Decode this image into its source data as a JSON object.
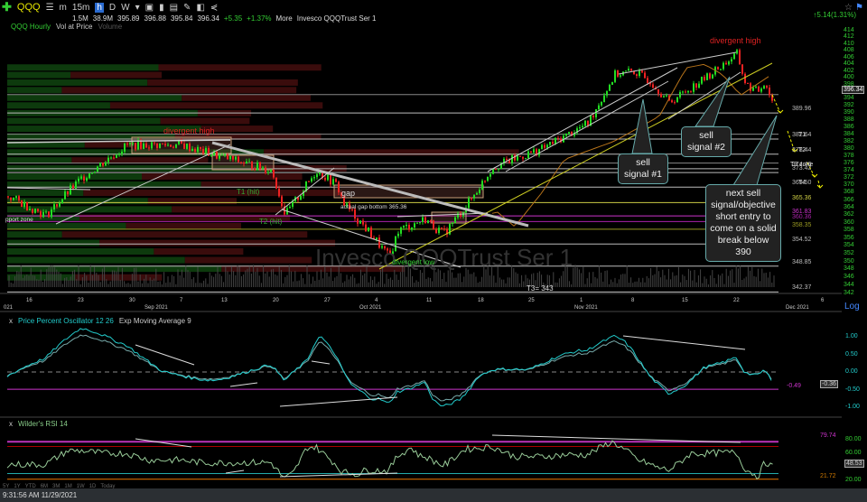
{
  "toolbar": {
    "symbol": "QQQ",
    "intervals": [
      "m",
      "15m",
      "h",
      "D",
      "W"
    ],
    "active_interval": "h"
  },
  "quote": {
    "volume": "1.5M",
    "avg_volume": "38.9M",
    "open": "395.89",
    "high": "396.88",
    "low": "395.84",
    "last": "396.34",
    "change": "+5.35",
    "change_pct": "+1.37%",
    "more": "More",
    "name": "Invesco QQQTrust Ser 1"
  },
  "right_change": "5.14(1.31%)",
  "legend": {
    "series": "QQQ Hourly",
    "vap": "Vol at Price",
    "volume": "Volume"
  },
  "watermark": "Invesco QQQTrust Ser 1",
  "price_axis": {
    "ticks": [
      414,
      412,
      410,
      408,
      406,
      404,
      402,
      400,
      398,
      396,
      394,
      392,
      390,
      388,
      386,
      384,
      382,
      380,
      378,
      376,
      374,
      372,
      370,
      368,
      366,
      364,
      362,
      360,
      358,
      356,
      354,
      352,
      350,
      348,
      346,
      344,
      342
    ],
    "current": "396.34",
    "scale": "Log"
  },
  "levels": [
    {
      "value": 389.96,
      "label": "389.96",
      "tag": "",
      "color": "#bbbbbb"
    },
    {
      "value": 382.64,
      "label": "382.64",
      "tag": "T1",
      "color": "#bbbbbb"
    },
    {
      "value": 378.44,
      "label": "378.44",
      "tag": "T2",
      "color": "#bbbbbb"
    },
    {
      "value": 374.46,
      "label": "374.46",
      "tag": "T3 zone",
      "color": "#bbbbbb"
    },
    {
      "value": 373.42,
      "label": "373.42",
      "tag": "",
      "color": "#bbbbbb"
    },
    {
      "value": 369.5,
      "label": "369.50",
      "tag": "T4",
      "color": "#bbbbbb"
    },
    {
      "value": 365.36,
      "label": "365.36",
      "tag": "",
      "color": "#cccc44"
    },
    {
      "value": 361.83,
      "label": "361.83",
      "tag": "",
      "color": "#cc33cc"
    },
    {
      "value": 360.36,
      "label": "360.36",
      "tag": "",
      "color": "#aa22aa"
    },
    {
      "value": 358.35,
      "label": "358.35",
      "tag": "",
      "color": "#999922"
    },
    {
      "value": 354.52,
      "label": "354.52",
      "tag": "",
      "color": "#bbbbbb"
    },
    {
      "value": 348.85,
      "label": "348.85",
      "tag": "",
      "color": "#bbbbbb"
    },
    {
      "value": 342.37,
      "label": "342.37",
      "tag": "",
      "color": "#bbbbbb"
    }
  ],
  "date_axis": {
    "days": [
      "16",
      "23",
      "30",
      "7",
      "13",
      "20",
      "27",
      "4",
      "11",
      "18",
      "25",
      "1",
      "8",
      "15",
      "22",
      "6"
    ],
    "months": [
      "Sep 2021",
      "Oct 2021",
      "Nov 2021",
      "Dec 2021"
    ],
    "left_month": "021"
  },
  "chart_data": {
    "type": "candlestick",
    "path": [
      [
        0,
        368
      ],
      [
        50,
        362
      ],
      [
        90,
        372
      ],
      [
        140,
        381
      ],
      [
        200,
        381
      ],
      [
        240,
        378
      ],
      [
        300,
        374
      ],
      [
        315,
        362
      ],
      [
        350,
        374
      ],
      [
        372,
        370
      ],
      [
        380,
        365
      ],
      [
        410,
        357
      ],
      [
        430,
        351
      ],
      [
        440,
        358
      ],
      [
        470,
        361
      ],
      [
        490,
        357
      ],
      [
        520,
        366
      ],
      [
        545,
        375
      ],
      [
        600,
        380
      ],
      [
        650,
        387
      ],
      [
        680,
        401
      ],
      [
        700,
        402
      ],
      [
        720,
        399
      ],
      [
        740,
        393
      ],
      [
        780,
        400
      ],
      [
        815,
        407
      ],
      [
        825,
        398
      ],
      [
        838,
        396
      ],
      [
        846,
        399
      ],
      [
        856,
        392
      ]
    ]
  },
  "annotations": {
    "divergent_high_1": "divergent high",
    "divergent_high_2": "divergent high",
    "divergent_low": "divergent low",
    "t1_hit": "T1 (hit)",
    "t2_hit": "T2 (hit)",
    "gap": "gap",
    "gap_bottom": "actual gap bottom 365.36",
    "support": "pport zone",
    "t3": "T3= 343"
  },
  "bubbles": {
    "sell1": "sell signal #1",
    "sell2": "sell signal #2",
    "next": "next sell signal/objective short entry to come on a solid break below 390"
  },
  "ppo": {
    "title": "Price Percent Oscillator 12 26",
    "ema": "Exp Moving Average 9",
    "ticks": [
      "1.00",
      "0.50",
      "0.00",
      "-0.50",
      "-1.00"
    ],
    "level": "-0.49",
    "current": "-0.36"
  },
  "rsi": {
    "title": "Wilder's RSI 14",
    "ticks": [
      "80.00",
      "60.00",
      "40.00",
      "20.00"
    ],
    "upper": "79.74",
    "lower": "21.72",
    "current": "48.53"
  },
  "ranges": [
    "5Y",
    "1Y",
    "YTD",
    "6M",
    "3M",
    "1M",
    "1W",
    "1D",
    "Today"
  ],
  "status": "9:31:56 AM 11/29/2021"
}
